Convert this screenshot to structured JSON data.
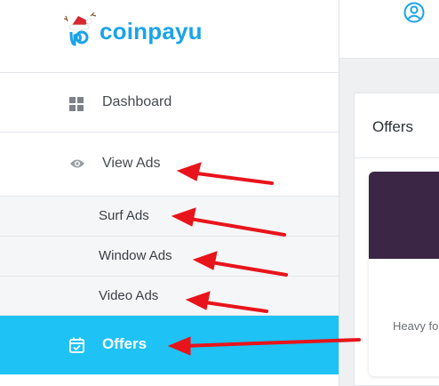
{
  "logo": {
    "text": "coinpayu"
  },
  "sidebar": {
    "items": [
      {
        "label": "Dashboard",
        "icon": "dashboard-grid-icon"
      },
      {
        "label": "View Ads",
        "icon": "eye-icon"
      }
    ],
    "sub_items": [
      {
        "label": "Surf Ads"
      },
      {
        "label": "Window Ads"
      },
      {
        "label": "Video Ads"
      }
    ],
    "active_item": {
      "label": "Offers",
      "icon": "calendar-check-icon"
    }
  },
  "main": {
    "card_title": "Offers",
    "offer_text": "Heavy fo"
  },
  "colors": {
    "accent": "#1ec2f4",
    "brand": "#1aa3e8",
    "annotation_arrow": "#e8141b",
    "offer_header": "#3b2645"
  }
}
